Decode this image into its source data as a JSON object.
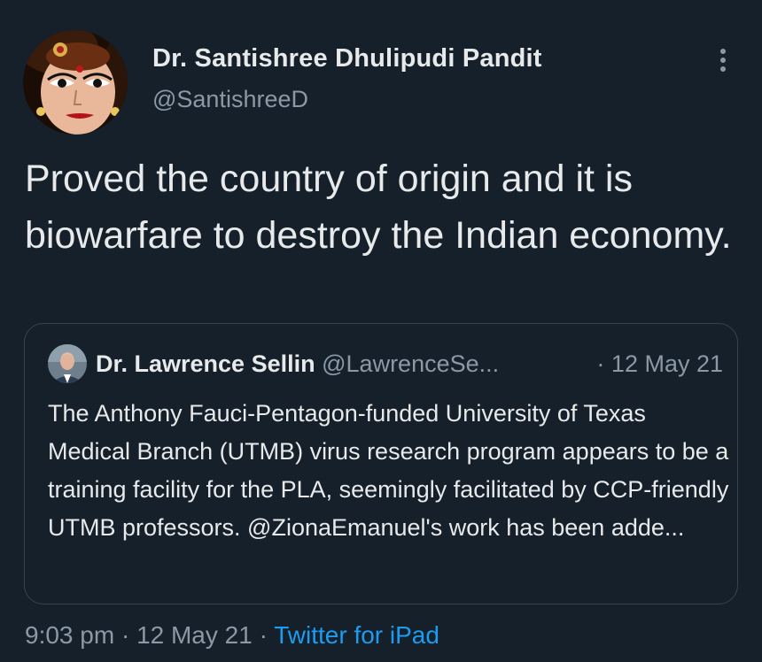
{
  "author": {
    "name": "Dr. Santishree Dhulipudi Pandit",
    "handle": "@SantishreeD",
    "avatar_icon": "goddess-face-avatar"
  },
  "tweet": {
    "text": "Proved the country of origin and it is biowarfare to destroy the Indian economy."
  },
  "quoted_tweet": {
    "name": "Dr. Lawrence Sellin",
    "handle": "@LawrenceSe...",
    "separator": "·",
    "date": "12 May 21",
    "text": "The Anthony Fauci-Pentagon-funded University of Texas Medical Branch (UTMB) virus research program appears to be a training facility for the PLA, seemingly facilitated by CCP-friendly UTMB professors. @ZionaEmanuel's work has been adde..."
  },
  "meta": {
    "time": "9:03 pm",
    "separator1": " · ",
    "date": "12 May 21",
    "separator2": " · ",
    "source": "Twitter for iPad"
  },
  "icons": {
    "more": "more-vertical-icon"
  },
  "colors": {
    "background": "#15202b",
    "primary_text": "#e7e9ea",
    "secondary_text": "#8b98a5",
    "accent": "#1d9bf0",
    "border": "#38444d"
  }
}
